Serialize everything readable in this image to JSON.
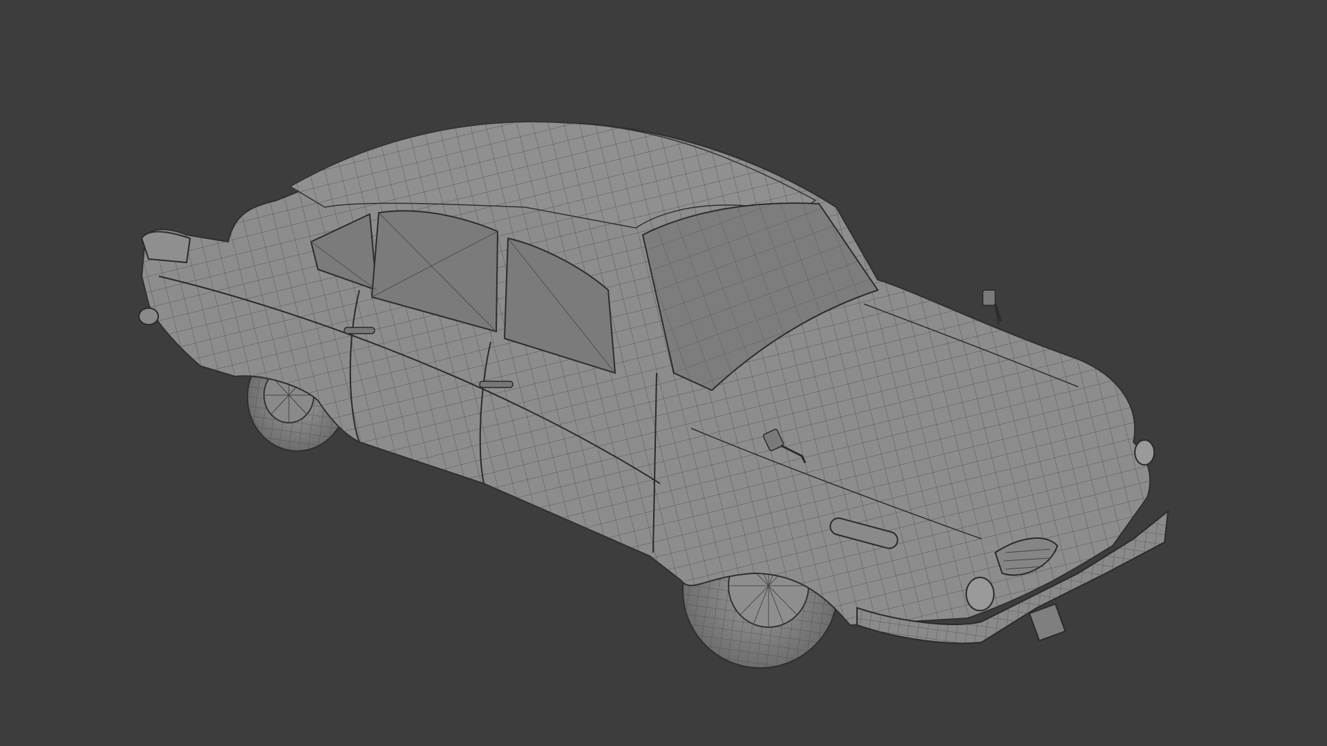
{
  "viewport": {
    "background": "#3d3d3d",
    "model_shading": "#8c8c8c",
    "wire_color": "#3a3a3a",
    "glass_shading": "#7a7a7a",
    "objects": [
      {
        "name": "car-body",
        "kind": "mesh"
      },
      {
        "name": "roof",
        "kind": "mesh"
      },
      {
        "name": "windshield",
        "kind": "mesh"
      },
      {
        "name": "side-windows",
        "kind": "mesh"
      },
      {
        "name": "front-wheel",
        "kind": "mesh"
      },
      {
        "name": "rear-wheel",
        "kind": "mesh"
      },
      {
        "name": "front-bumper",
        "kind": "mesh"
      },
      {
        "name": "headlights",
        "kind": "mesh"
      },
      {
        "name": "side-mirrors",
        "kind": "mesh"
      },
      {
        "name": "door-handles",
        "kind": "mesh"
      }
    ]
  }
}
